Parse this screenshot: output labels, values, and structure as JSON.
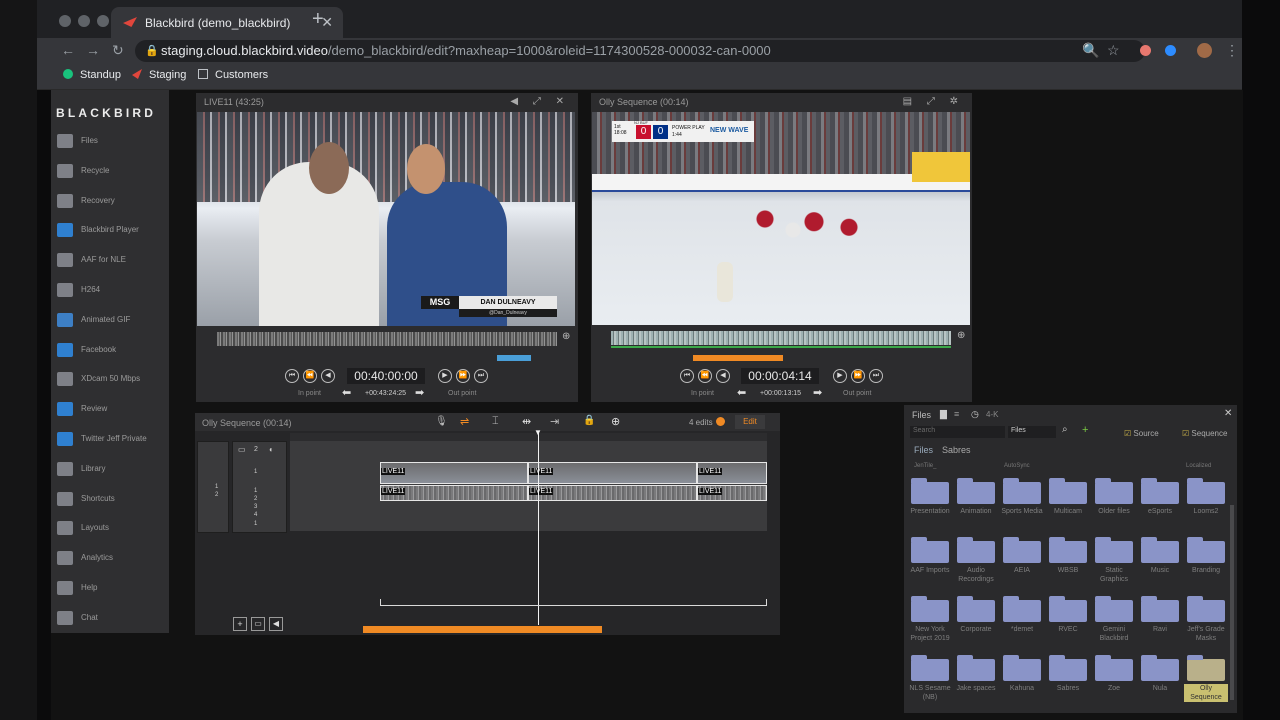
{
  "browser": {
    "tab_title": "Blackbird (demo_blackbird)",
    "url_host": "staging.cloud.blackbird.video",
    "url_path": "/demo_blackbird/edit?maxheap=1000&roleid=1174300528-000032-can-0000",
    "bookmarks": [
      "Standup",
      "Staging",
      "Customers"
    ]
  },
  "app": {
    "logo": "BLACKBIRD",
    "sidebar": [
      {
        "label": "Files",
        "icon": "folder-icon"
      },
      {
        "label": "Recycle",
        "icon": "recycle-icon"
      },
      {
        "label": "Recovery",
        "icon": "recovery-icon"
      },
      {
        "label": "Blackbird Player",
        "icon": "globe-icon"
      },
      {
        "label": "AAF for NLE",
        "icon": "document-icon"
      },
      {
        "label": "H264",
        "icon": "calendar-icon"
      },
      {
        "label": "Animated GIF",
        "icon": "gif-icon"
      },
      {
        "label": "Facebook",
        "icon": "facebook-icon"
      },
      {
        "label": "XDcam 50 Mbps",
        "icon": "film-icon"
      },
      {
        "label": "Review",
        "icon": "globe-icon"
      },
      {
        "label": "Twitter Jeff Private",
        "icon": "twitter-icon"
      },
      {
        "label": "Library",
        "icon": "library-icon"
      },
      {
        "label": "Shortcuts",
        "icon": "keyboard-icon"
      },
      {
        "label": "Layouts",
        "icon": "layout-icon"
      },
      {
        "label": "Analytics",
        "icon": "bar-chart-icon"
      },
      {
        "label": "Help",
        "icon": "help-icon"
      },
      {
        "label": "Chat",
        "icon": "chat-icon"
      }
    ],
    "source_viewer": {
      "title": "LIVE11 (43:25)",
      "timecode": "00:40:00:00",
      "sub_timecode": "+00:43:24:25",
      "in_label": "In point",
      "out_label": "Out point",
      "lower_third_brand": "MSG",
      "lower_third_name": "DAN DULNEAVY",
      "lower_third_handle": "@Dan_Dulneavy"
    },
    "program_viewer": {
      "title": "Olly Sequence (00:14)",
      "timecode": "00:00:04:14",
      "sub_timecode": "+00:00:13:15",
      "in_label": "In point",
      "out_label": "Out point",
      "score_left": "0",
      "score_right": "0",
      "score_teams": "NJ  BUF",
      "period": "1st 18:08",
      "power_play": "POWER PLAY 1:44",
      "sponsor": "NEW WAVE"
    },
    "timeline": {
      "title": "Olly Sequence (00:14)",
      "edits_label": "4 edits",
      "edit_button": "Edit",
      "video_track_count": "2",
      "track_labels": [
        "1",
        "1",
        "2",
        "1",
        "2",
        "3",
        "4",
        "1"
      ],
      "clip_label": "LIVE11"
    },
    "files": {
      "title": "Files",
      "tab_4k": "4-K",
      "search_placeholder": "Search",
      "filter": "Files",
      "source_label": "Source",
      "sequence_label": "Sequence",
      "tabs": [
        "Files",
        "Sabres"
      ],
      "header_cols": [
        "JenTile_",
        "AutoSync",
        "Localized"
      ],
      "folders": [
        "Presentation",
        "Animation",
        "Sports Media",
        "Multicam",
        "Older files",
        "eSports",
        "Looms2",
        "AAF Imports",
        "Audio Recordings",
        "AEIA",
        "WBSB",
        "Static Graphics",
        "Music",
        "Branding",
        "New York Project 2019",
        "Corporate",
        "*demet",
        "RVEC",
        "Gemini Blackbird",
        "Ravi",
        "Jeff's Grade Masks",
        "NLS Sesame (NB)",
        "Jake spaces",
        "Kahuna",
        "Sabres",
        "Zoe",
        "Nula",
        "Olly Sequence"
      ]
    }
  }
}
